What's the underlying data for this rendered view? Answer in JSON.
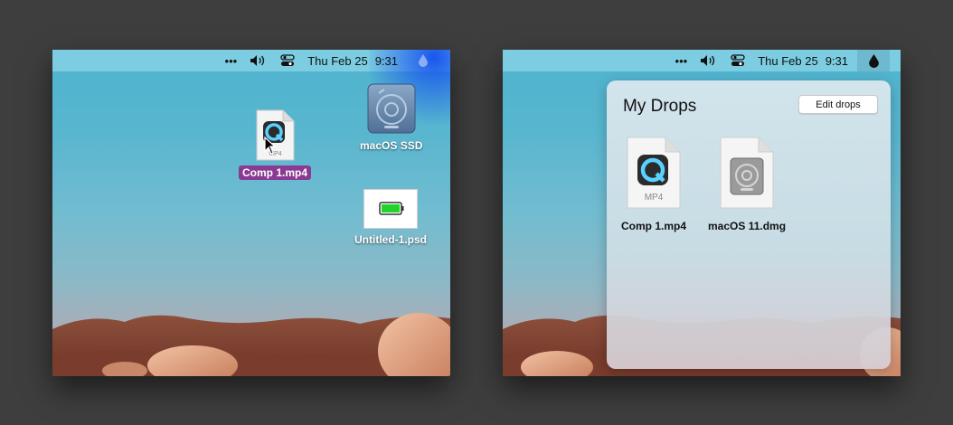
{
  "menubar": {
    "more": "•••",
    "day": "Thu Feb 25",
    "time": "9:31"
  },
  "left_desktop": {
    "selected_file": {
      "label": "Comp 1.mp4",
      "file_type": "MP4",
      "icon": "quicktime-mp4-file-icon"
    },
    "drive": {
      "label": "macOS SSD",
      "icon": "hard-drive-icon"
    },
    "psd": {
      "label": "Untitled-1.psd",
      "icon": "psd-battery-thumbnail-icon"
    }
  },
  "drops_popover": {
    "title": "My Drops",
    "edit_button": "Edit drops",
    "items": [
      {
        "label": "Comp 1.mp4",
        "file_type": "MP4",
        "icon": "quicktime-mp4-file-icon"
      },
      {
        "label": "macOS 11.dmg",
        "icon": "dmg-disk-image-icon"
      }
    ]
  },
  "colors": {
    "selection": "#8a3a92",
    "battery_green": "#22d42a",
    "background": "#3e3e3e"
  }
}
